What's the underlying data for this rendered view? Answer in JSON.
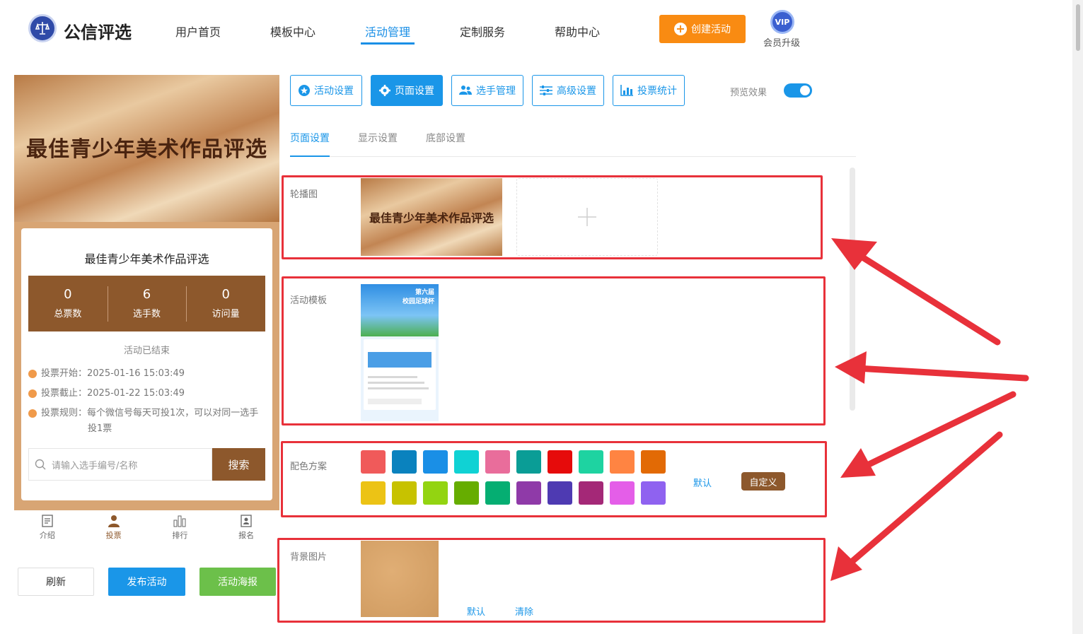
{
  "header": {
    "logo_text": "公信评选",
    "nav": [
      "用户首页",
      "模板中心",
      "活动管理",
      "定制服务",
      "帮助中心"
    ],
    "active_nav": "活动管理",
    "create_button": "创建活动",
    "vip_badge": "VIP",
    "vip_label": "会员升级"
  },
  "preview": {
    "banner_title": "最佳青少年美术作品评选",
    "card_title": "最佳青少年美术作品评选",
    "stats": [
      {
        "value": "0",
        "label": "总票数"
      },
      {
        "value": "6",
        "label": "选手数"
      },
      {
        "value": "0",
        "label": "访问量"
      }
    ],
    "status": "活动已结束",
    "vote_start": "投票开始：2025-01-16 15:03:49",
    "vote_end": "投票截止：2025-01-22 15:03:49",
    "vote_rule_line1": "投票规则：每个微信号每天可投1次，可以对同一选手",
    "vote_rule_line2": "投1票",
    "search_placeholder": "请输入选手编号/名称",
    "search_button": "搜索",
    "tabs": [
      "介绍",
      "投票",
      "排行",
      "报名"
    ],
    "active_tab": "投票"
  },
  "actions": {
    "refresh": "刷新",
    "publish": "发布活动",
    "poster": "活动海报"
  },
  "settings": {
    "top_tabs": [
      "活动设置",
      "页面设置",
      "选手管理",
      "高级设置",
      "投票统计"
    ],
    "active_top_tab": "页面设置",
    "preview_toggle_label": "预览效果",
    "preview_toggle_on": true,
    "sub_tabs": [
      "页面设置",
      "显示设置",
      "底部设置"
    ],
    "active_sub_tab": "页面设置",
    "carousel_label": "轮播图",
    "carousel_image_text": "最佳青少年美术作品评选",
    "template_label": "活动模板",
    "template_thumb_text": "第六届\n校园足球杯",
    "color_label": "配色方案",
    "colors": [
      "#f05a5a",
      "#0a82be",
      "#1a8fe6",
      "#10d2d4",
      "#e96d9b",
      "#0a9d96",
      "#e60b0b",
      "#1ed3a1",
      "#ff8442",
      "#e26a05",
      "#ecc315",
      "#c7c200",
      "#93d411",
      "#66ad00",
      "#05ae72",
      "#8f3aa8",
      "#4e3ab2",
      "#a42877",
      "#e45ee8",
      "#8f62f0"
    ],
    "color_default": "默认",
    "color_custom": "自定义",
    "background_label": "背景图片",
    "background_default": "默认",
    "background_clear": "清除",
    "accent": "#1a96e8",
    "theme_brown": "#8d582c"
  }
}
